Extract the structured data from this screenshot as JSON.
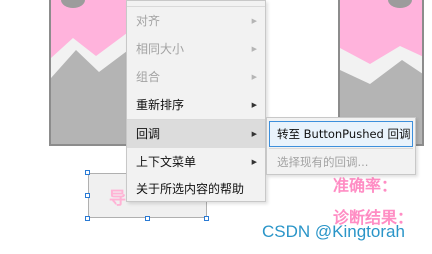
{
  "context_menu": {
    "items": [
      {
        "label": "对齐",
        "enabled": false,
        "has_submenu": true
      },
      {
        "label": "相同大小",
        "enabled": false,
        "has_submenu": true
      },
      {
        "label": "组合",
        "enabled": false,
        "has_submenu": true
      },
      {
        "label": "重新排序",
        "enabled": true,
        "has_submenu": true
      },
      {
        "label": "回调",
        "enabled": true,
        "has_submenu": true,
        "highlighted": true
      },
      {
        "label": "上下文菜单",
        "enabled": true,
        "has_submenu": true
      },
      {
        "label": "关于所选内容的帮助",
        "enabled": true,
        "has_submenu": false
      }
    ]
  },
  "submenu": {
    "items": [
      {
        "label": "转至 ButtonPushed 回调",
        "enabled": true
      },
      {
        "label": "选择现有的回调...",
        "enabled": false
      }
    ]
  },
  "canvas": {
    "button_label": "导",
    "accuracy_label": "准确率：",
    "diagnosis_label": "诊断结果："
  },
  "watermark": "CSDN @Kingtorah",
  "colors": {
    "image_pink": "#ffb3dc",
    "mountain_gray": "#b4b4b4",
    "label_pink": "#ff8dc4",
    "selection_blue": "#2a7ad4"
  }
}
